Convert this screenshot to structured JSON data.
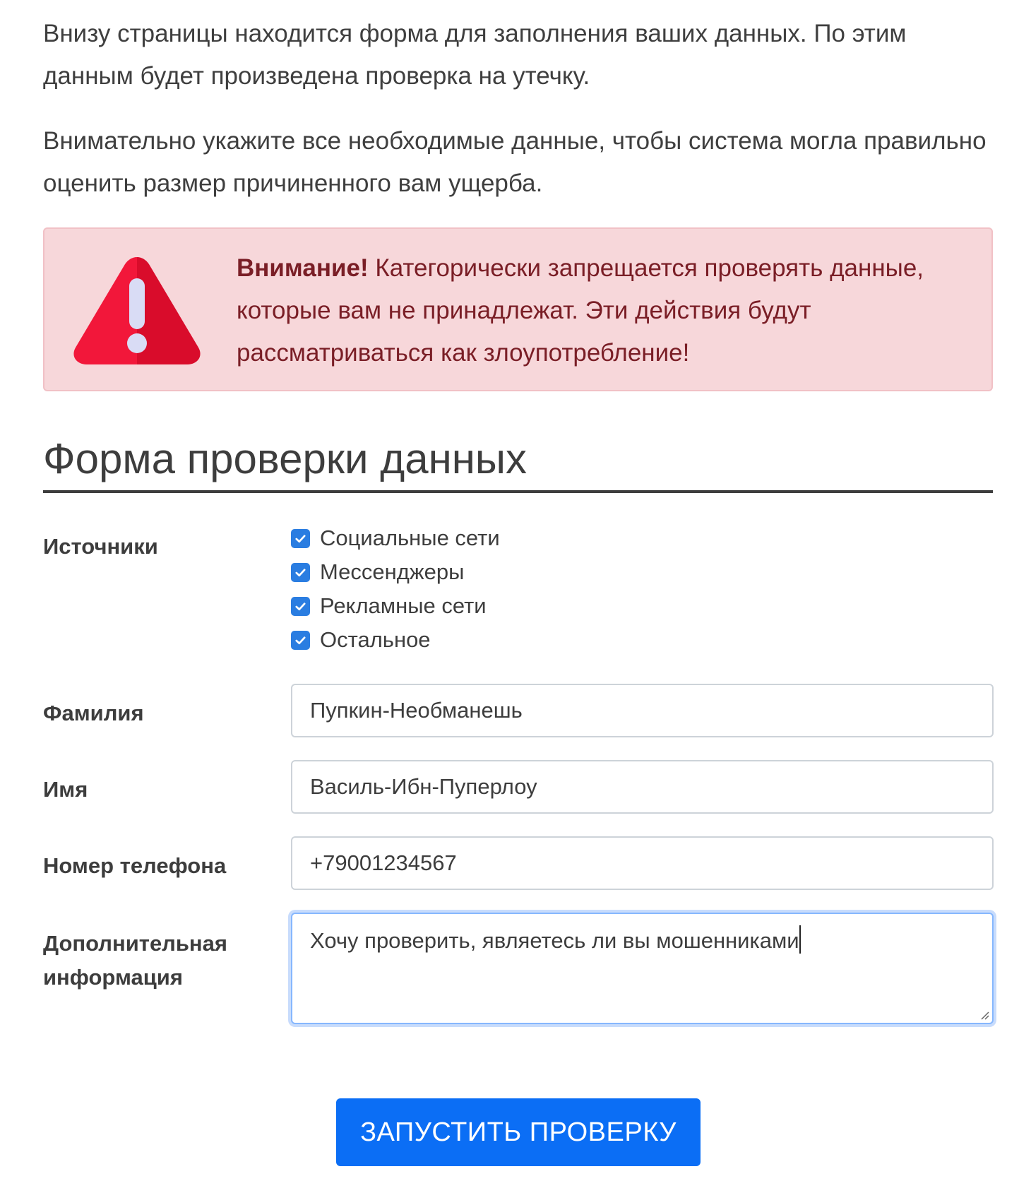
{
  "intro": {
    "paragraph1": "Внизу страницы находится форма для заполнения ваших данных. По этим данным будет произведена проверка на утечку.",
    "paragraph2": "Внимательно укажите все необходимые данные, чтобы система могла правильно оценить размер причиненного вам ущерба."
  },
  "alert": {
    "icon": "warning-triangle-icon",
    "strong": "Внимание!",
    "text": " Категорически запрещается проверять данные, которые вам не принадлежат. Эти действия будут рассматриваться как злоупотребление!",
    "colors": {
      "background": "#f7d7da",
      "text": "#7a1e26",
      "icon_red": "#e8132f"
    }
  },
  "form": {
    "title": "Форма проверки данных",
    "sources": {
      "label": "Источники",
      "options": [
        {
          "label": "Социальные сети",
          "checked": true
        },
        {
          "label": "Мессенджеры",
          "checked": true
        },
        {
          "label": "Рекламные сети",
          "checked": true
        },
        {
          "label": "Остальное",
          "checked": true
        }
      ]
    },
    "last_name": {
      "label": "Фамилия",
      "value": "Пупкин-Необманешь"
    },
    "first_name": {
      "label": "Имя",
      "value": "Василь-Ибн-Пуперлоу"
    },
    "phone": {
      "label": "Номер телефона",
      "value": "+79001234567"
    },
    "extra": {
      "label_line1": "Дополнительная",
      "label_line2": "информация",
      "value": "Хочу проверить, являетесь ли вы мошенниками"
    },
    "submit_label": "ЗАПУСТИТЬ ПРОВЕРКУ"
  },
  "colors": {
    "accent": "#0b6ef5",
    "checkbox": "#2a7de1",
    "focus_border": "#86b7fe"
  }
}
